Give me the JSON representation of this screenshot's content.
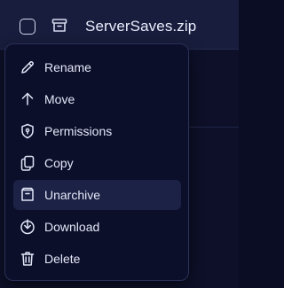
{
  "file": {
    "name": "ServerSaves.zip",
    "icon": "archive-icon",
    "selected": false
  },
  "menu": {
    "items": [
      {
        "label": "Rename",
        "icon": "pencil-icon",
        "active": false
      },
      {
        "label": "Move",
        "icon": "arrow-up-icon",
        "active": false
      },
      {
        "label": "Permissions",
        "icon": "shield-icon",
        "active": false
      },
      {
        "label": "Copy",
        "icon": "copy-icon",
        "active": false
      },
      {
        "label": "Unarchive",
        "icon": "unarchive-icon",
        "active": true
      },
      {
        "label": "Download",
        "icon": "download-icon",
        "active": false
      },
      {
        "label": "Delete",
        "icon": "trash-icon",
        "active": false
      }
    ]
  },
  "colors": {
    "page_background": "#0a0d24",
    "row_background": "#181d3d",
    "menu_background": "#0c0f2a",
    "menu_border": "#2a3058",
    "active_item": "#1c2245",
    "text": "#e4e7f7"
  }
}
